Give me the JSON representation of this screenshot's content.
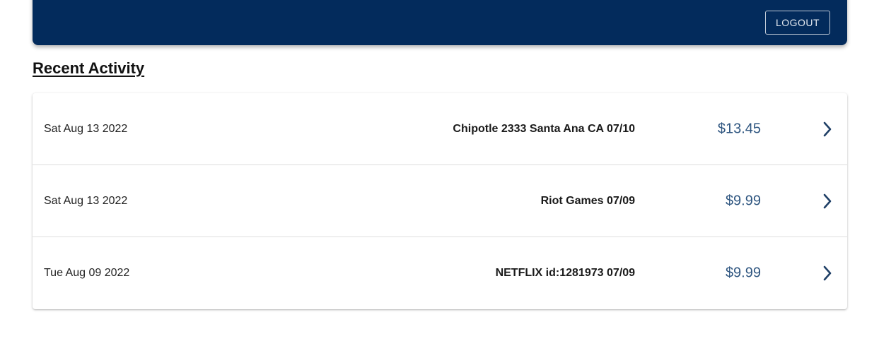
{
  "header": {
    "logout_label": "LOGOUT"
  },
  "section": {
    "title": "Recent Activity"
  },
  "activity": {
    "rows": [
      {
        "date": "Sat Aug 13 2022",
        "description": "Chipotle 2333 Santa Ana CA 07/10",
        "amount": "$13.45",
        "icon": "chevron-right-icon"
      },
      {
        "date": "Sat Aug 13 2022",
        "description": "Riot Games 07/09",
        "amount": "$9.99",
        "icon": "chevron-right-icon"
      },
      {
        "date": "Tue Aug 09 2022",
        "description": "NETFLIX id:1281973 07/09",
        "amount": "$9.99",
        "icon": "chevron-right-icon"
      }
    ]
  },
  "colors": {
    "header_bg": "#032b5c",
    "amount": "#2f5680",
    "chevron": "#1f3f66"
  }
}
